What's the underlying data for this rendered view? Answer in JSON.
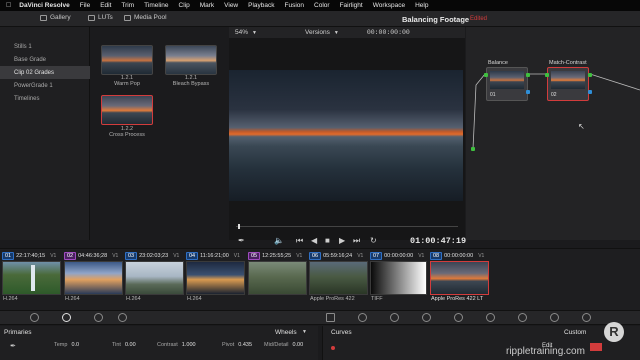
{
  "menubar": {
    "apple": "",
    "app": "DaVinci Resolve",
    "items": [
      "File",
      "Edit",
      "Trim",
      "Timeline",
      "Clip",
      "Mark",
      "View",
      "Playback",
      "Fusion",
      "Color",
      "Fairlight",
      "Workspace",
      "Help"
    ]
  },
  "toolbar": {
    "gallery": "Gallery",
    "luts": "LUTs",
    "media_pool": "Media Pool",
    "project_title": "Balancing Footage",
    "edited": "Edited"
  },
  "albums": [
    "Stills 1",
    "Base Grade",
    "Clip 02 Grades",
    "PowerGrade 1",
    "Timelines"
  ],
  "selected_album": "Clip 02 Grades",
  "stills": [
    {
      "id": "1.2.1",
      "name": "Warm Pop"
    },
    {
      "id": "1.2.1",
      "name": "Bleach Bypass"
    },
    {
      "id": "1.2.2",
      "name": "Cross Process"
    }
  ],
  "viewer": {
    "zoom": "54%",
    "versions": "Versions",
    "timecode_top": "00:00:00:00",
    "timecode": "01:00:47:19"
  },
  "nodes": [
    {
      "label": "Balance",
      "num": "01"
    },
    {
      "label": "Match-Contrast",
      "num": "02"
    }
  ],
  "clips": [
    {
      "num": "01",
      "tc": "22:17:40;15",
      "track": "V1",
      "codec": "H.264",
      "cls": "c1"
    },
    {
      "num": "02",
      "tc": "04:46:36;28",
      "track": "V1",
      "codec": "H.264",
      "cls": "c2"
    },
    {
      "num": "03",
      "tc": "23:02:03;23",
      "track": "V1",
      "codec": "H.264",
      "cls": "c3"
    },
    {
      "num": "04",
      "tc": "11:16:21;00",
      "track": "V1",
      "codec": "H.264",
      "cls": "c4"
    },
    {
      "num": "05",
      "tc": "12:25:55;25",
      "track": "V1",
      "codec": "",
      "cls": "c5"
    },
    {
      "num": "06",
      "tc": "05:59:16;24",
      "track": "V1",
      "codec": "Apple ProRes 422",
      "cls": "c6"
    },
    {
      "num": "07",
      "tc": "00:00:00:00",
      "track": "V1",
      "codec": "TIFF",
      "cls": "c7"
    },
    {
      "num": "08",
      "tc": "00:00:00:00",
      "track": "V1",
      "codec": "Apple ProRes 422 LT",
      "cls": "c8"
    }
  ],
  "primaries": {
    "title": "Primaries",
    "mode": "Wheels",
    "fields": [
      {
        "label": "Temp",
        "value": "0.0"
      },
      {
        "label": "Tint",
        "value": "0.00"
      },
      {
        "label": "Contrast",
        "value": "1.000"
      },
      {
        "label": "Pivot",
        "value": "0.435"
      },
      {
        "label": "Mid/Detail",
        "value": "0.00"
      }
    ]
  },
  "curves": {
    "title": "Curves",
    "mode": "Custom",
    "edit": "Edit"
  },
  "watermark": "rippletraining.com",
  "logo": "R",
  "colors": {
    "accent": "#d23c3c",
    "blue": "#2f6fc4",
    "magenta": "#a04cc0"
  }
}
